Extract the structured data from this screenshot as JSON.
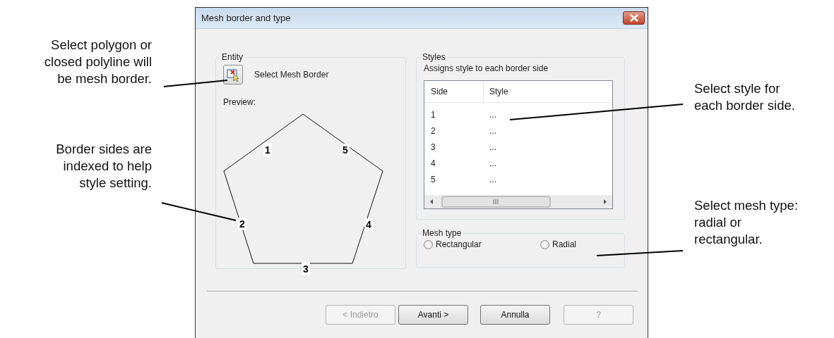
{
  "callouts_left": [
    {
      "text": "Select polygon or\nclosed polyline will\nbe mesh border."
    },
    {
      "text": "Border sides are\nindexed to help\nstyle setting."
    }
  ],
  "dialog": {
    "title": "Mesh border and type",
    "entity": {
      "title": "Entity",
      "select_button_label": "Select Mesh Border",
      "preview_label": "Preview:",
      "side_labels": [
        "1",
        "2",
        "3",
        "4",
        "5"
      ]
    },
    "styles": {
      "title": "Styles",
      "description": "Assigns style to each border side",
      "columns": [
        "Side",
        "Style"
      ],
      "rows": [
        {
          "side": "1",
          "style": "..."
        },
        {
          "side": "2",
          "style": "..."
        },
        {
          "side": "3",
          "style": "..."
        },
        {
          "side": "4",
          "style": "..."
        },
        {
          "side": "5",
          "style": "..."
        }
      ]
    },
    "mesh_type": {
      "title": "Mesh type",
      "options": [
        {
          "label": "Rectangular",
          "selected": false
        },
        {
          "label": "Radial",
          "selected": false
        }
      ]
    },
    "buttons": [
      {
        "label": "< Indietro",
        "disabled": true
      },
      {
        "label": "Avanti >",
        "disabled": false
      },
      {
        "label": "Annulla",
        "disabled": false
      },
      {
        "label": "?",
        "disabled": true
      }
    ]
  },
  "callouts_right": [
    {
      "text": "Select style for\neach border side."
    },
    {
      "text": "Select mesh type:\nradial or\nrectangular."
    }
  ]
}
